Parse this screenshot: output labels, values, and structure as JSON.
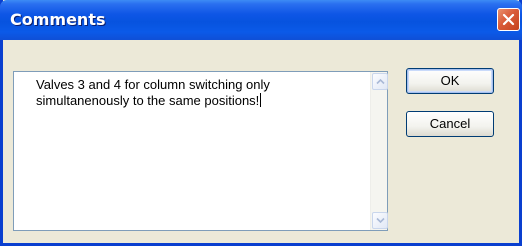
{
  "window": {
    "title": "Comments"
  },
  "memo": {
    "value": "Valves 3 and 4 for column switching only\nsimultanenously to the same positions!"
  },
  "buttons": {
    "ok_label": "OK",
    "cancel_label": "Cancel"
  },
  "icons": {
    "close": "close-icon",
    "scroll_up": "scroll-up-arrow-icon",
    "scroll_down": "scroll-down-arrow-icon"
  },
  "colors": {
    "titlebar": "#0753df",
    "close_button": "#d95a38",
    "dialog_background": "#ece9d8",
    "button_border": "#003c74"
  }
}
